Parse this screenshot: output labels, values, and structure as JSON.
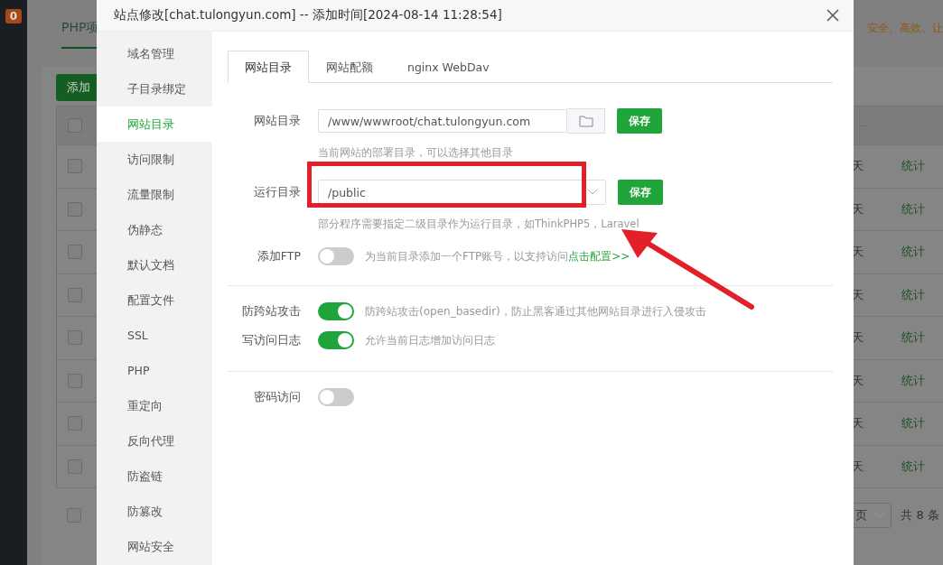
{
  "background": {
    "badge": "0",
    "tab": "PHP项",
    "notice": "安全、高效、让",
    "add_button": "添加",
    "header_checked": false,
    "footer_checked": false,
    "rows": [
      {
        "checked": false,
        "column_3": "天",
        "action": "统计"
      },
      {
        "checked": false,
        "column_3": "天",
        "action": "统计"
      },
      {
        "checked": false,
        "column_3": "天",
        "action": "统计"
      },
      {
        "checked": false,
        "column_3": "天",
        "action": "统计"
      },
      {
        "checked": false,
        "column_3": "天",
        "action": "统计"
      },
      {
        "checked": false,
        "column_3": "天",
        "action": "统计"
      },
      {
        "checked": false,
        "column_3": "天",
        "action": "统计"
      },
      {
        "checked": false,
        "column_3": "天",
        "action": "统计"
      }
    ],
    "page_select": "页",
    "total": "共 8 条"
  },
  "dialog": {
    "title": "站点修改[chat.tulongyun.com] -- 添加时间[2024-08-14 11:28:54]",
    "sidebar": [
      {
        "label": "域名管理",
        "selected": false
      },
      {
        "label": "子目录绑定",
        "selected": false
      },
      {
        "label": "网站目录",
        "selected": true
      },
      {
        "label": "访问限制",
        "selected": false
      },
      {
        "label": "流量限制",
        "selected": false
      },
      {
        "label": "伪静态",
        "selected": false
      },
      {
        "label": "默认文档",
        "selected": false
      },
      {
        "label": "配置文件",
        "selected": false
      },
      {
        "label": "SSL",
        "selected": false
      },
      {
        "label": "PHP",
        "selected": false
      },
      {
        "label": "重定向",
        "selected": false
      },
      {
        "label": "反向代理",
        "selected": false
      },
      {
        "label": "防盗链",
        "selected": false
      },
      {
        "label": "防篡改",
        "selected": false
      },
      {
        "label": "网站安全",
        "selected": false
      }
    ],
    "tabs": [
      {
        "label": "网站目录",
        "selected": true
      },
      {
        "label": "网站配额",
        "selected": false
      },
      {
        "label": "nginx WebDav",
        "selected": false
      }
    ],
    "site_dir": {
      "label": "网站目录",
      "value": "/www/wwwroot/chat.tulongyun.com",
      "button": "保存",
      "hint": "当前网站的部署目录，可以选择其他目录"
    },
    "run_dir": {
      "label": "运行目录",
      "value": "/public",
      "button": "保存",
      "hint": "部分程序需要指定二级目录作为运行目录，如ThinkPHP5，Laravel"
    },
    "ftp": {
      "label": "添加FTP",
      "on": false,
      "hint": "为当前目录添加一个FTP账号，以支持访问",
      "link": "点击配置>>"
    },
    "switches": [
      {
        "label": "防跨站攻击",
        "on": true,
        "hint": "防跨站攻击(open_basedir)，防止黑客通过其他网站目录进行入侵攻击"
      },
      {
        "label": "写访问日志",
        "on": true,
        "hint": "允许当前日志增加访问日志"
      }
    ],
    "password": {
      "label": "密码访问",
      "on": false
    }
  }
}
